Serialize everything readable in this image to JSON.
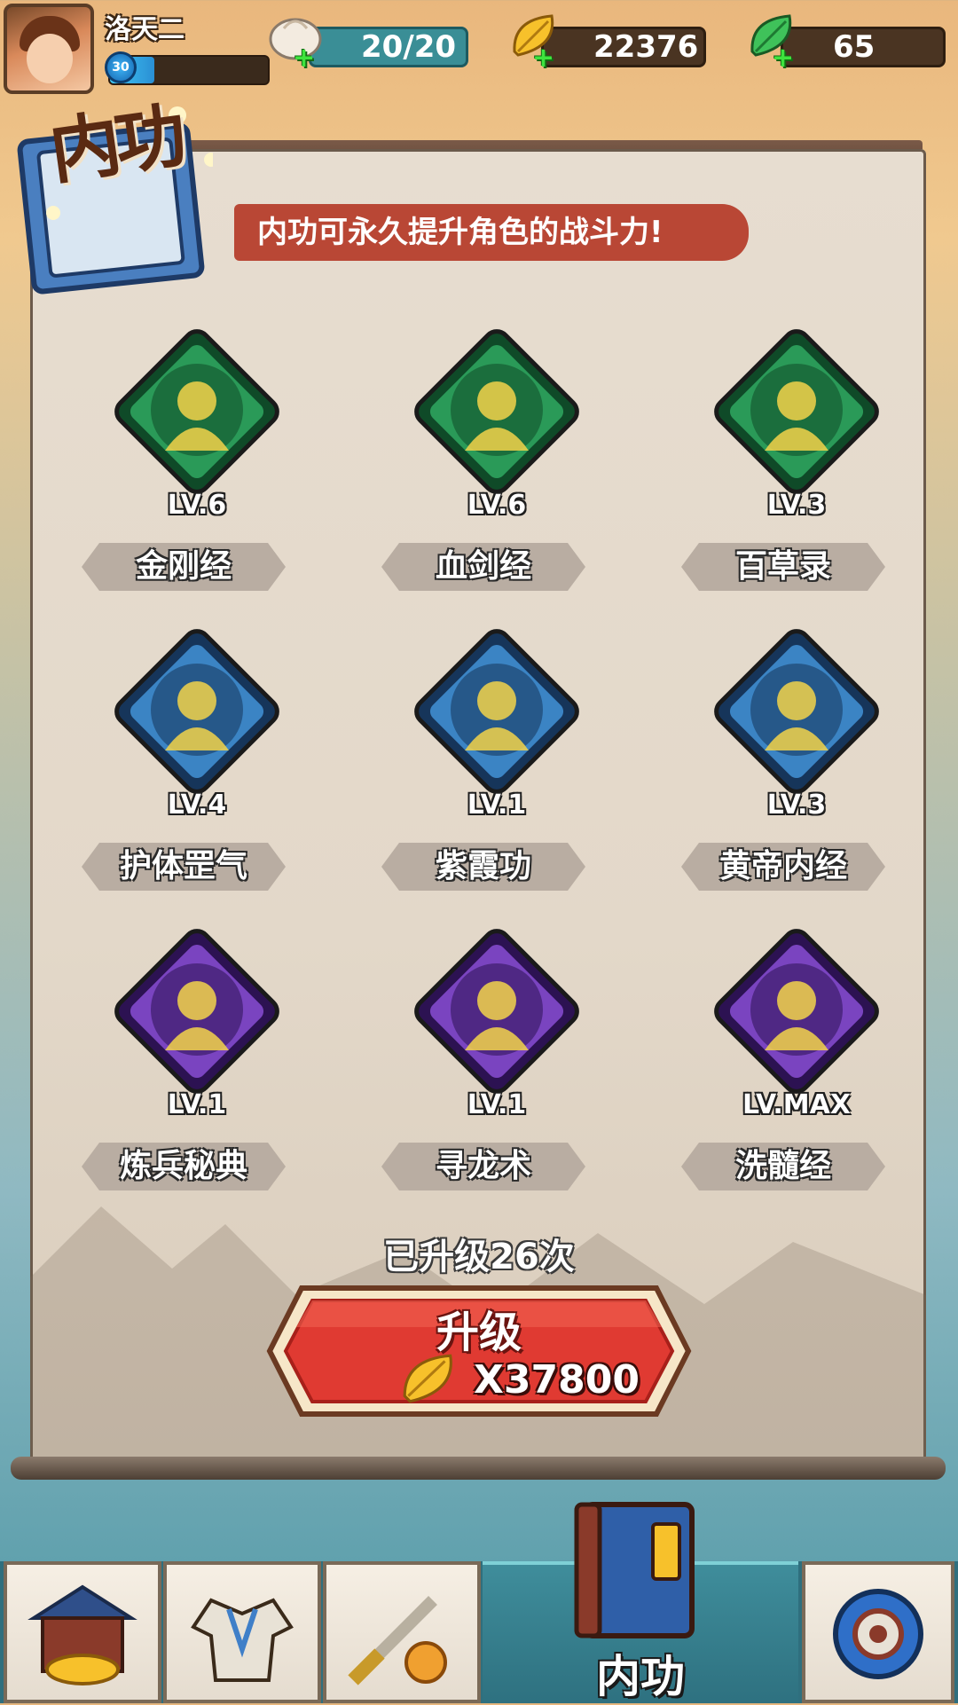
{
  "player": {
    "name": "洛天二",
    "level": "30",
    "xp_progress": 0.28
  },
  "resources": {
    "stamina": "20/20",
    "gold": "22376",
    "jade": "65"
  },
  "header": {
    "logo_text": "内功",
    "tagline": "内功可永久提升角色的战斗力!"
  },
  "skills": [
    {
      "name": "金刚经",
      "level": "LV.6",
      "frame": "green",
      "icon": "muscle-silhouette-icon"
    },
    {
      "name": "血剑经",
      "level": "LV.6",
      "frame": "green",
      "icon": "blood-sword-icon"
    },
    {
      "name": "百草录",
      "level": "LV.3",
      "frame": "green",
      "icon": "herb-leaf-icon"
    },
    {
      "name": "护体罡气",
      "level": "LV.4",
      "frame": "blue",
      "icon": "golden-aura-body-icon"
    },
    {
      "name": "紫霞功",
      "level": "LV.1",
      "frame": "blue",
      "icon": "palm-strike-icon"
    },
    {
      "name": "黄帝内经",
      "level": "LV.3",
      "frame": "blue",
      "icon": "healing-figure-icon"
    },
    {
      "name": "炼兵秘典",
      "level": "LV.1",
      "frame": "purple",
      "icon": "anvil-icon"
    },
    {
      "name": "寻龙术",
      "level": "LV.1",
      "frame": "purple",
      "icon": "gold-ingot-icon"
    },
    {
      "name": "洗髓经",
      "level": "LV.MAX",
      "frame": "purple",
      "icon": "red-spirit-icon"
    }
  ],
  "upgrade": {
    "count_text": "已升级26次",
    "button_label": "升级",
    "cost": "X37800"
  },
  "bottom_nav": {
    "active_label": "内功",
    "items": [
      "shop-icon",
      "armor-icon",
      "weapon-icon",
      "neigong-book-icon",
      "settings-gear-icon"
    ]
  },
  "colors": {
    "frame_green": "#1f8a4a",
    "frame_blue": "#2a6fa8",
    "frame_purple": "#6a3aa8",
    "tagline_red": "#b94735",
    "button_red": "#e03a32"
  }
}
